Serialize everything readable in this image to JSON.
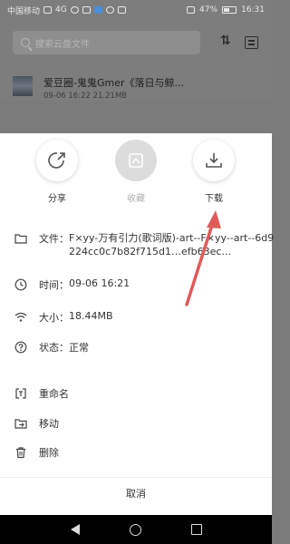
{
  "status_bar": {
    "carrier": "中国移动",
    "signal_text": "4G",
    "battery": "47%",
    "time": "16:31"
  },
  "background": {
    "search_placeholder": "搜索云盘文件",
    "file": {
      "name": "爱豆圈-鬼鬼Gmer《落日与鲸...",
      "date": "09-06 16:22",
      "size": "21.21MB"
    }
  },
  "actions": [
    {
      "label": "分享",
      "icon": "share-icon",
      "enabled": true
    },
    {
      "label": "收藏",
      "icon": "favorite-icon",
      "enabled": false
    },
    {
      "label": "下载",
      "icon": "download-icon",
      "enabled": true
    }
  ],
  "details": {
    "file_label": "文件：",
    "file_value": "F×yy-万有引力(歌词版)-art--F×yy--art--6d9224cc0c7b82f715d1…efb63ec…",
    "time_label": "时间：",
    "time_value": "09-06 16:21",
    "size_label": "大小：",
    "size_value": "18.44MB",
    "status_label": "状态：",
    "status_value": "正常"
  },
  "menu": {
    "rename": "重命名",
    "move": "移动",
    "delete": "删除"
  },
  "cancel_label": "取消",
  "colors": {
    "overlay": "#7b7b7b",
    "sheet": "#ffffff",
    "pointer": "#e05a5a",
    "disabled": "#dcdcdc"
  }
}
